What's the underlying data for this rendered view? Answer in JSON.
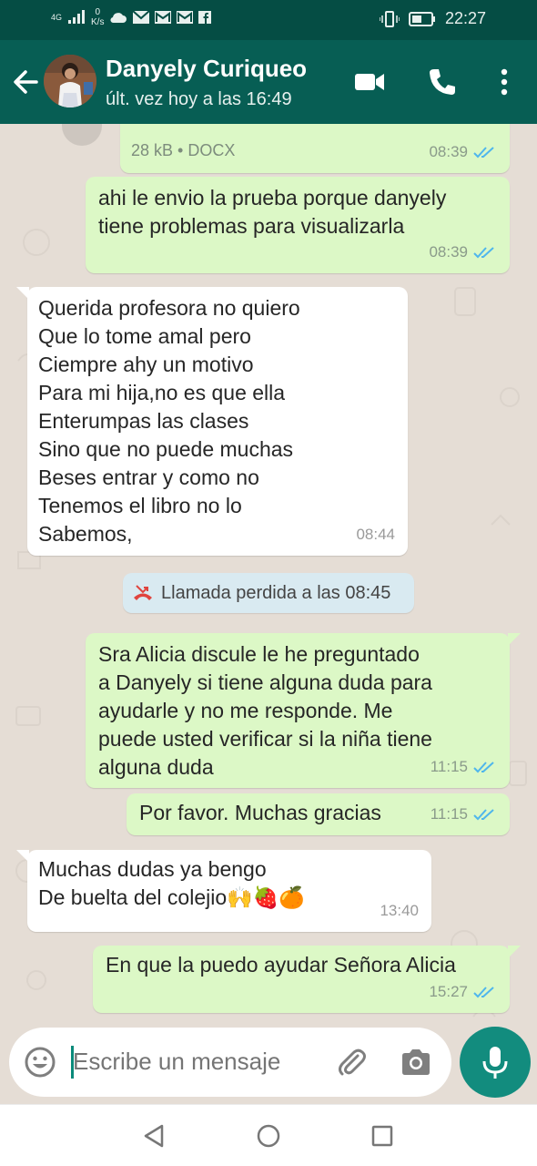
{
  "status": {
    "network": "4G",
    "speed_value": "0",
    "speed_unit": "K/s",
    "time": "22:27"
  },
  "header": {
    "contact_name": "Danyely Curiqueo",
    "last_seen": "últ. vez hoy a las 16:49"
  },
  "messages": [
    {
      "id": "m1",
      "direction": "out",
      "file_info": "28 kB • DOCX",
      "time": "08:39",
      "read": true
    },
    {
      "id": "m2",
      "direction": "out",
      "text": "ahi le envio la prueba porque danyely\ntiene problemas para visualizarla",
      "time": "08:39",
      "read": true
    },
    {
      "id": "m3",
      "direction": "in",
      "text": "Querida profesora no quiero\nQue lo tome amal pero\nCiempre ahy un motivo\nPara mi hija,no es que ella\nEnterumpas las clases\nSino que no puede muchas\nBeses entrar y como no\nTenemos el libro no lo\nSabemos,",
      "time": "08:44"
    },
    {
      "id": "sys1",
      "direction": "system",
      "text": "Llamada perdida a las 08:45"
    },
    {
      "id": "m4",
      "direction": "out",
      "text": "Sra Alicia discule le he preguntado\na Danyely si tiene alguna duda para\nayudarle y no me responde. Me\npuede usted verificar si la niña tiene\nalguna duda",
      "time": "11:15",
      "read": true
    },
    {
      "id": "m5",
      "direction": "out",
      "text": "Por favor. Muchas gracias",
      "time": "11:15",
      "read": true
    },
    {
      "id": "m6",
      "direction": "in",
      "text": "Muchas dudas ya bengo\nDe buelta del colejio🙌🍓🍊",
      "time": "13:40"
    },
    {
      "id": "m7",
      "direction": "out",
      "text": "En que la puedo ayudar Señora Alicia",
      "time": "15:27",
      "read": true
    }
  ],
  "composer": {
    "placeholder": "Escribe un mensaje"
  },
  "colors": {
    "header": "#075e54",
    "status_bar": "#054d44",
    "outgoing_bubble": "#dcf8c6",
    "incoming_bubble": "#ffffff",
    "read_ticks": "#4fb6ec",
    "mic_button": "#128c7e",
    "missed_call": "#e0443e",
    "chat_background": "#e5ddd5"
  },
  "icons": {
    "back": "arrow-left-icon",
    "video": "video-camera-icon",
    "call": "phone-icon",
    "menu": "more-vert-icon",
    "emoji": "emoji-icon",
    "attach": "paperclip-icon",
    "camera": "camera-icon",
    "mic": "microphone-icon",
    "missed_call": "missed-call-icon",
    "nav_back": "triangle-back-icon",
    "nav_home": "circle-home-icon",
    "nav_recents": "square-recents-icon"
  }
}
